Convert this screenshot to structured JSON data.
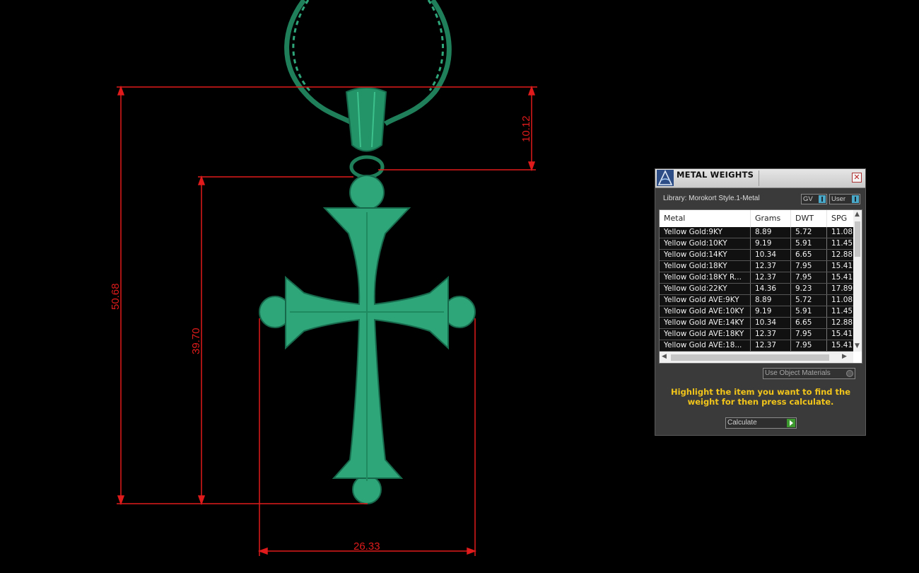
{
  "viewport": {
    "dimensions": [
      {
        "id": "total_height",
        "value": "50.68"
      },
      {
        "id": "cross_height",
        "value": "39.70"
      },
      {
        "id": "bail_height",
        "value": "10.12"
      },
      {
        "id": "cross_width",
        "value": "26.33"
      }
    ],
    "colors": {
      "background": "#000000",
      "dimension": "#e01b1b",
      "model": "#2fa57a"
    }
  },
  "panel": {
    "title": "METAL WEIGHTS",
    "close_icon": "close-icon",
    "library_label": "Library: Morokort Style.1-Metal",
    "gv_label": "GV",
    "user_label": "User",
    "columns": [
      "Metal",
      "Grams",
      "DWT",
      "SPG"
    ],
    "rows": [
      [
        "Yellow Gold:9KY",
        "8.89",
        "5.72",
        "11.08"
      ],
      [
        "Yellow Gold:10KY",
        "9.19",
        "5.91",
        "11.45"
      ],
      [
        "Yellow Gold:14KY",
        "10.34",
        "6.65",
        "12.88"
      ],
      [
        "Yellow Gold:18KY",
        "12.37",
        "7.95",
        "15.41"
      ],
      [
        "Yellow Gold:18KY R...",
        "12.37",
        "7.95",
        "15.41"
      ],
      [
        "Yellow Gold:22KY",
        "14.36",
        "9.23",
        "17.89"
      ],
      [
        "Yellow Gold AVE:9KY",
        "8.89",
        "5.72",
        "11.08"
      ],
      [
        "Yellow Gold AVE:10KY",
        "9.19",
        "5.91",
        "11.45"
      ],
      [
        "Yellow Gold AVE:14KY",
        "10.34",
        "6.65",
        "12.88"
      ],
      [
        "Yellow Gold AVE:18KY",
        "12.37",
        "7.95",
        "15.41"
      ],
      [
        "Yellow Gold AVE:18...",
        "12.37",
        "7.95",
        "15.41"
      ]
    ],
    "use_object_materials": "Use Object Materials",
    "hint": "Highlight the item you want to find the weight for then press calculate.",
    "calculate_label": "Calculate",
    "accent_hint": "#f2c51b"
  }
}
